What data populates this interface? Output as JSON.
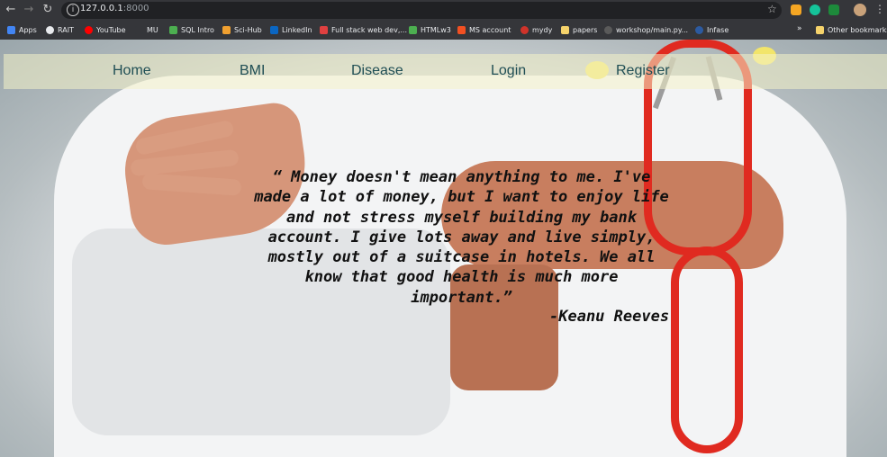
{
  "browser": {
    "url_host": "127.0.0.1",
    "url_port": ":8000",
    "bookmarks": [
      {
        "label": "Apps",
        "icon": "apps-grid-icon",
        "color": "#4285f4"
      },
      {
        "label": "RAIT",
        "icon": "globe-icon",
        "color": "#e8eaed"
      },
      {
        "label": "YouTube",
        "icon": "youtube-icon",
        "color": "#ff0000"
      },
      {
        "label": "MU",
        "icon": "mu-icon",
        "color": "#35363a"
      },
      {
        "label": "SQL Intro",
        "icon": "w3-icon",
        "color": "#4caf50"
      },
      {
        "label": "Sci-Hub",
        "icon": "scihub-icon",
        "color": "#f0a030"
      },
      {
        "label": "LinkedIn",
        "icon": "linkedin-icon",
        "color": "#0a66c2"
      },
      {
        "label": "Full stack web dev,...",
        "icon": "fullstack-icon",
        "color": "#e04040"
      },
      {
        "label": "HTMLw3",
        "icon": "w3-icon",
        "color": "#4caf50"
      },
      {
        "label": "MS account",
        "icon": "microsoft-icon",
        "color": "#f25022"
      },
      {
        "label": "mydy",
        "icon": "mydy-icon",
        "color": "#d0332a"
      },
      {
        "label": "papers",
        "icon": "folder-icon",
        "color": "#f6d36b"
      },
      {
        "label": "workshop/main.py...",
        "icon": "github-icon",
        "color": "#5a5a5a"
      },
      {
        "label": "Infase",
        "icon": "infase-icon",
        "color": "#2c5aa0"
      }
    ],
    "more_label": "»",
    "other_bookmarks": "Other bookmarks"
  },
  "nav": {
    "home": "Home",
    "bmi": "BMI",
    "disease": "Disease",
    "login": "Login",
    "register": "Register"
  },
  "quote": {
    "text": "“ Money doesn't mean anything to me. I've made a lot of money, but I want to enjoy life and not stress myself building my bank account. I give lots away and live simply, mostly out of a suitcase in hotels. We all know that good health is much more important.”",
    "author": "-Keanu Reeves"
  }
}
